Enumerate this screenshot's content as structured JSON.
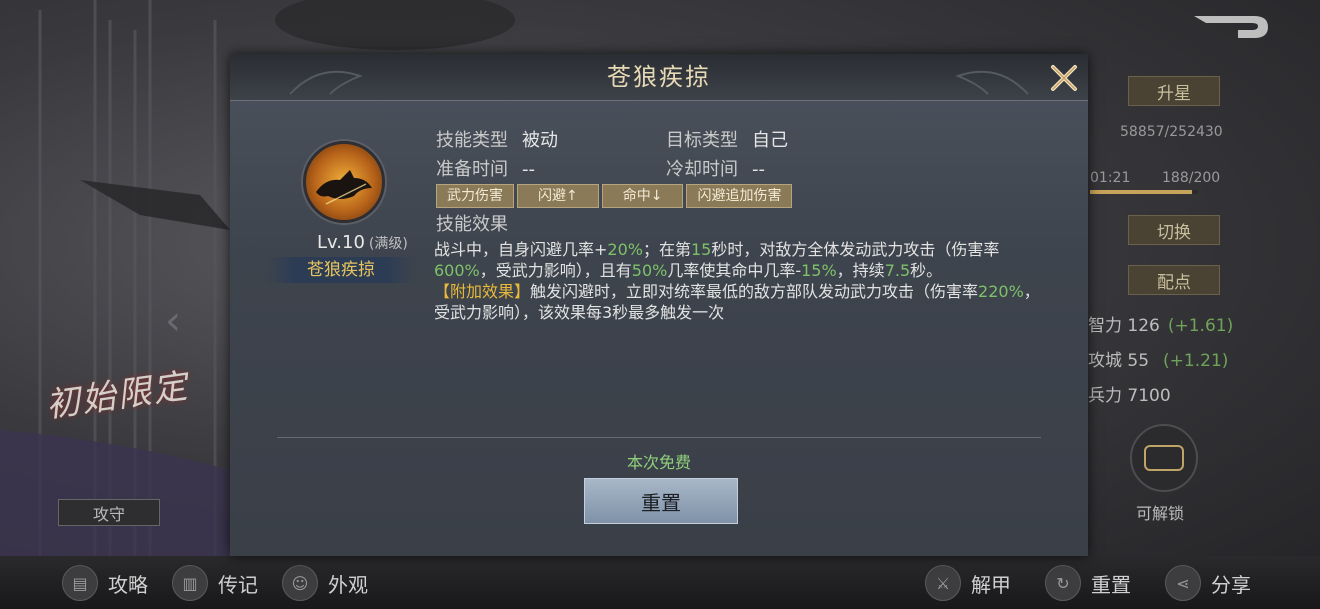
{
  "colors": {
    "accent_gold": "#e8b93a",
    "value_green": "#7dc26a",
    "title_text": "#e6d9b5",
    "button_bg": "#8fa0b5"
  },
  "background": {
    "upgrade_star_label": "升星",
    "exp_value": "58857/252430",
    "timer": "01:21",
    "capacity": "188/200",
    "capacity_progress": 0.94,
    "switch_label": "切换",
    "allocate_label": "配点",
    "stats": [
      {
        "name": "智力",
        "value": "126",
        "bonus": "(+1.61)"
      },
      {
        "name": "攻城",
        "value": "55",
        "bonus": "(+1.21)"
      },
      {
        "name": "兵力",
        "value": "7100",
        "bonus": ""
      }
    ],
    "unlock_label": "可解锁",
    "promo_text": "初始限定",
    "attack_defense_label": "攻守"
  },
  "bottom_bar": {
    "items": [
      {
        "label": "攻略",
        "icon": "book-icon"
      },
      {
        "label": "传记",
        "icon": "scroll-icon"
      },
      {
        "label": "外观",
        "icon": "appearance-icon"
      },
      {
        "label": "解甲",
        "icon": "armor-icon"
      },
      {
        "label": "重置",
        "icon": "reset-icon"
      },
      {
        "label": "分享",
        "icon": "share-icon"
      }
    ]
  },
  "modal": {
    "title": "苍狼疾掠",
    "skill_icon": "wolf-icon",
    "level": "Lv.10",
    "level_max": "(满级)",
    "skill_name": "苍狼疾掠",
    "fields": {
      "skill_type_label": "技能类型",
      "skill_type_value": "被动",
      "target_type_label": "目标类型",
      "target_type_value": "自己",
      "prep_time_label": "准备时间",
      "prep_time_value": "--",
      "cooldown_label": "冷却时间",
      "cooldown_value": "--"
    },
    "tags": [
      "武力伤害",
      "闪避↑",
      "命中↓",
      "闪避追加伤害"
    ],
    "effect_title": "技能效果",
    "effect": {
      "p1": "战斗中，自身闪避几率+",
      "v1": "20%",
      "p2": "；在第",
      "v2": "15",
      "p3": "秒时，对敌方全体发动武力攻击（伤害率",
      "v3": "600%",
      "p4": "，受武力影响），且有",
      "v4": "50%",
      "p5": "几率使其命中几率-",
      "v5": "15%",
      "p6": "，持续",
      "v6": "7.5",
      "p7": "秒。",
      "bonus_label": "【附加效果】",
      "p8": "触发闪避时，立即对统率最低的敌方部队发动武力攻击（伤害率",
      "v7": "220%",
      "p9": "，受武力影响），该效果每3秒最多触发一次"
    },
    "free_text": "本次免费",
    "reset_label": "重置"
  }
}
